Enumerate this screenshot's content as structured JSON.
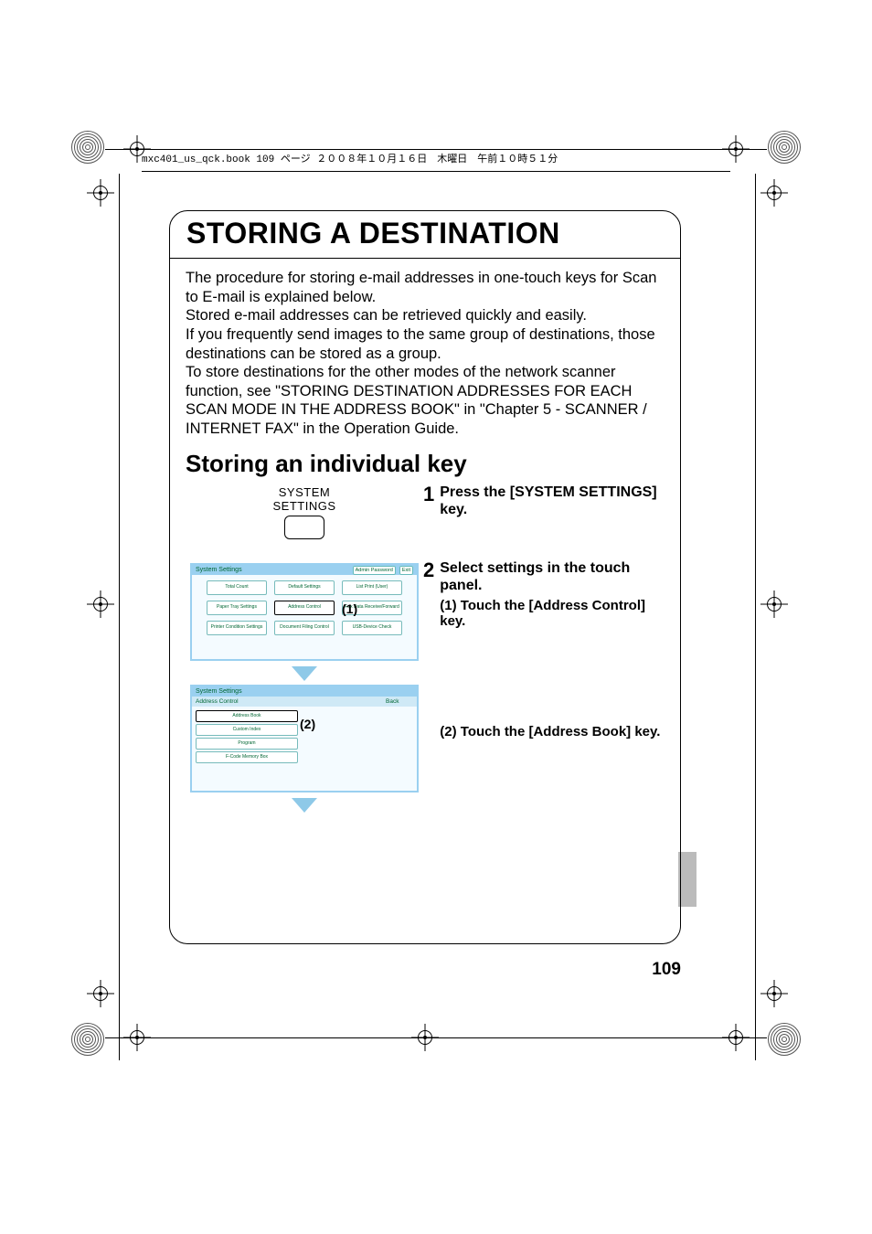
{
  "header_line": "mxc401_us_qck.book  109 ページ  ２００８年１０月１６日　木曜日　午前１０時５１分",
  "main_title": "STORING A DESTINATION",
  "intro": "The procedure for storing e-mail addresses in one-touch keys for Scan to E-mail is explained below.\nStored e-mail addresses can be retrieved quickly and easily.\nIf you frequently send images to the same group of destinations, those destinations can be stored as a group.\nTo store destinations for the other modes of the network scanner function, see \"STORING DESTINATION ADDRESSES FOR EACH SCAN MODE IN THE ADDRESS BOOK\" in \"Chapter 5 - SCANNER / INTERNET FAX\" in the Operation Guide.",
  "sub_title": "Storing an individual key",
  "system_key": {
    "line1": "SYSTEM",
    "line2": "SETTINGS"
  },
  "steps": {
    "s1": {
      "num": "1",
      "text": "Press the [SYSTEM SETTINGS] key."
    },
    "s2": {
      "num": "2",
      "text": "Select settings in the touch panel.",
      "sub1_tag": "(1)",
      "sub1": "Touch the [Address Control] key.",
      "sub2_tag": "(2)",
      "sub2": "Touch the [Address Book] key."
    }
  },
  "panel1": {
    "title": "System Settings",
    "header_btns": {
      "admin": "Admin Password",
      "exit": "Exit"
    },
    "buttons": {
      "total_count": "Total Count",
      "default_settings": "Default Settings",
      "list_print": "List Print (User)",
      "paper_tray": "Paper Tray Settings",
      "address_control": "Address Control",
      "fax_data": "Fax Data Receive/Forward",
      "printer_cond": "Printer Condition Settings",
      "doc_filing": "Document Filing Control",
      "usb_check": "USB-Device Check"
    },
    "callout": "(1)"
  },
  "panel2": {
    "title": "System Settings",
    "subtitle": "Address Control",
    "back": "Back",
    "items": {
      "address_book": "Address Book",
      "custom_index": "Custom Index",
      "program": "Program",
      "fcode": "F-Code Memory Box"
    },
    "callout": "(2)"
  },
  "page_number": "109"
}
